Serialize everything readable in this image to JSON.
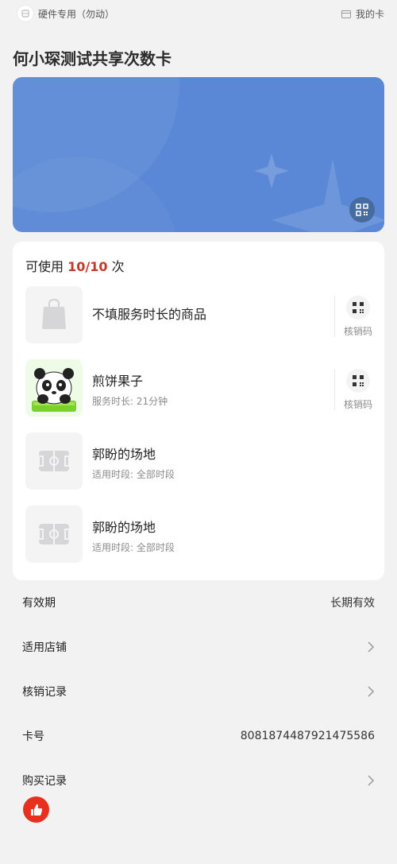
{
  "topbar": {
    "hardware_label": "硬件专用（勿动）",
    "my_card_label": "我的卡"
  },
  "card": {
    "title": "何小琛测试共享次数卡",
    "colors": {
      "hero": "#5a88d6",
      "accent": "#c0392b"
    }
  },
  "usage": {
    "prefix": "可使用",
    "count": "10/10",
    "suffix": "次"
  },
  "items": [
    {
      "name": "不填服务时长的商品",
      "sub": "",
      "verify_label": "核销码",
      "icon": "shopping-bag-icon"
    },
    {
      "name": "煎饼果子",
      "sub": "服务时长: 21分钟",
      "verify_label": "核销码",
      "icon": "panda-image"
    },
    {
      "name": "郭盼的场地",
      "sub": "适用时段: 全部时段",
      "icon": "field-icon"
    },
    {
      "name": "郭盼的场地",
      "sub": "适用时段: 全部时段",
      "icon": "field-icon"
    }
  ],
  "info": {
    "validity_label": "有效期",
    "validity_value": "长期有效",
    "stores_label": "适用店铺",
    "records_label": "核销记录",
    "card_no_label": "卡号",
    "card_no_value": "8081874487921475586",
    "purchase_label": "购买记录"
  }
}
